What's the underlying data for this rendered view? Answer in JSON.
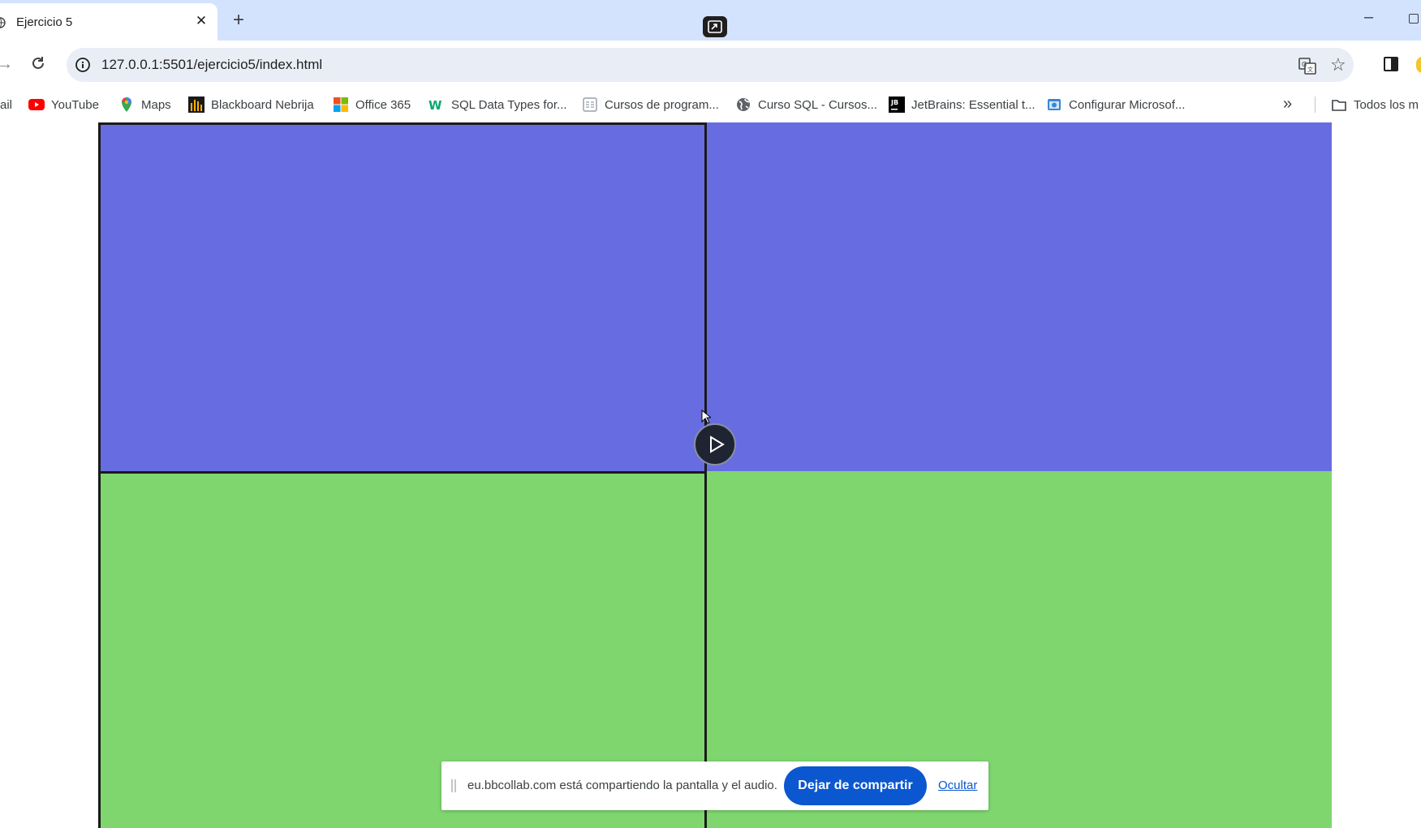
{
  "tab": {
    "title": "Ejercicio 5"
  },
  "address_bar": {
    "url": "127.0.0.1:5501/ejercicio5/index.html"
  },
  "bookmarks": [
    {
      "label": "ail",
      "icon": "gmail-icon"
    },
    {
      "label": "YouTube",
      "icon": "youtube-icon"
    },
    {
      "label": "Maps",
      "icon": "maps-icon"
    },
    {
      "label": "Blackboard Nebrija",
      "icon": "blackboard-icon"
    },
    {
      "label": "Office 365",
      "icon": "microsoft-icon"
    },
    {
      "label": "SQL Data Types for...",
      "icon": "w3schools-icon"
    },
    {
      "label": "Cursos de program...",
      "icon": "page-icon"
    },
    {
      "label": "Curso SQL - Cursos...",
      "icon": "globe-icon"
    },
    {
      "label": "JetBrains: Essential t...",
      "icon": "jetbrains-icon"
    },
    {
      "label": "Configurar Microsof...",
      "icon": "edge-icon"
    }
  ],
  "bookmarks_folder": {
    "label": "Todos los m"
  },
  "share_bar": {
    "message": "eu.bbcollab.com está compartiendo la pantalla y el audio.",
    "stop_label": "Dejar de compartir",
    "hide_label": "Ocultar"
  },
  "colors": {
    "blue_panel": "#676de1",
    "green_panel": "#7fd66f",
    "border": "#1a1a1a",
    "accent": "#0b57d0"
  }
}
